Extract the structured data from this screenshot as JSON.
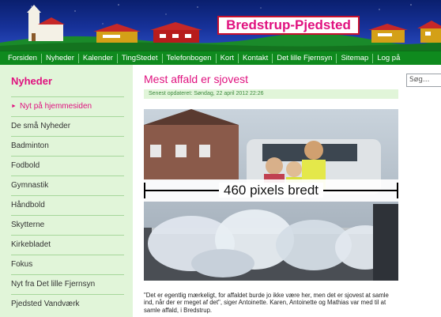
{
  "header": {
    "site_title": "Bredstrup-Pjedsted",
    "colors": {
      "sky": "#17329a",
      "title_text": "#e0117f",
      "title_border": "#c8102e",
      "house_roof": "#c62828",
      "house_wall": "#d4a017"
    }
  },
  "nav": {
    "items": [
      "Forsiden",
      "Nyheder",
      "Kalender",
      "TingStedet",
      "Telefonbogen",
      "Kort",
      "Kontakt",
      "Det lille Fjernsyn",
      "Sitemap",
      "Log på"
    ],
    "color": "#0f8a1e"
  },
  "sidebar": {
    "heading": "Nyheder",
    "items": [
      {
        "label": "Nyt på hjemmesiden",
        "active": true
      },
      {
        "label": "De små Nyheder"
      },
      {
        "label": "Badminton"
      },
      {
        "label": "Fodbold"
      },
      {
        "label": "Gymnastik"
      },
      {
        "label": "Håndbold"
      },
      {
        "label": "Skytterne"
      },
      {
        "label": "Kirkebladet"
      },
      {
        "label": "Fokus"
      },
      {
        "label": "Nyt fra Det lille Fjernsyn"
      },
      {
        "label": "Pjedsted Vandværk"
      }
    ]
  },
  "article": {
    "title": "Mest affald er sjovest",
    "updated": "Senest opdateret: Søndag, 22 april 2012 22:26",
    "image_label": "460 pixels bredt",
    "body": "\"Det er egentlig mærkeligt, for affaldet burde jo ikke være her, men det er sjovest at samle ind, når der er meget af det\", siger Antoinette. Karen, Antoinette og Mathias var med til at samle affald, i Bredstrup."
  },
  "search": {
    "placeholder": "Søg..."
  }
}
